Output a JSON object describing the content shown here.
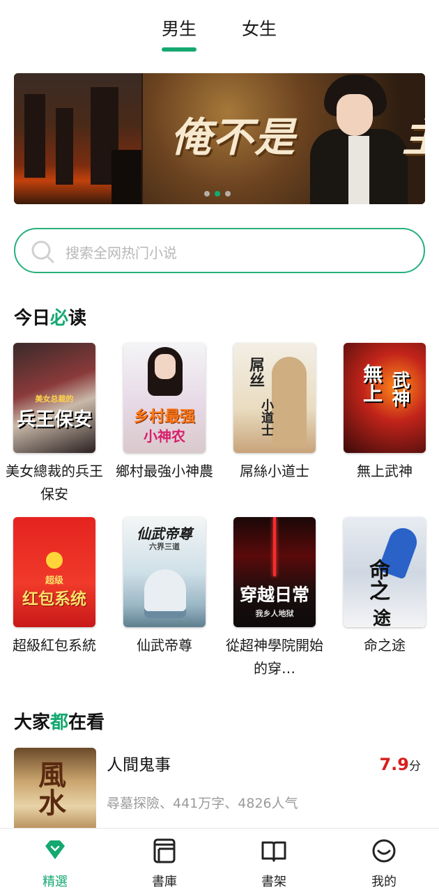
{
  "colors": {
    "accent": "#15a870",
    "score": "#d81e1e",
    "muted": "#9a9a9a"
  },
  "tabs": {
    "male": "男生",
    "female": "女生",
    "active": "male"
  },
  "banner": {
    "title_main": "俺不是",
    "title_tail": "主",
    "slide_count": 3,
    "active_slide": 2
  },
  "search": {
    "placeholder": "搜索全网热门小说",
    "icon": "search-icon"
  },
  "today": {
    "title_pre": "今日",
    "title_accent": "必",
    "title_post": "读",
    "books": [
      {
        "title": "美女總裁的兵王保安",
        "cover_text": "兵王保安",
        "cover_sub": "美女总裁的"
      },
      {
        "title": "鄉村最強小神農",
        "cover_text": "乡村最强",
        "cover_sub": "小神农"
      },
      {
        "title": "屌絲小道士",
        "cover_text": "屌丝",
        "cover_sub": "小道士"
      },
      {
        "title": "無上武神",
        "cover_text": "無上",
        "cover_sub": "武神"
      },
      {
        "title": "超級紅包系統",
        "cover_text": "红包系统",
        "cover_sub": "超级"
      },
      {
        "title": "仙武帝尊",
        "cover_text": "仙武帝尊",
        "cover_sub": "六界三道"
      },
      {
        "title": "從超神學院開始的穿…",
        "cover_text": "穿越日常",
        "cover_sub": "我乡人地狱"
      },
      {
        "title": "命之途",
        "cover_text": "命之",
        "cover_sub": "途"
      }
    ]
  },
  "popular": {
    "title_pre": "大家",
    "title_accent": "都",
    "title_post": "在看",
    "items": [
      {
        "title": "人間鬼事",
        "meta": "尋墓探險、441万字、4826人气",
        "score": "7.9",
        "score_unit": "分",
        "cover_text": "風水"
      }
    ]
  },
  "nav": [
    {
      "label": "精選",
      "icon": "diamond-icon",
      "active": true
    },
    {
      "label": "書庫",
      "icon": "library-icon",
      "active": false
    },
    {
      "label": "書架",
      "icon": "bookshelf-icon",
      "active": false
    },
    {
      "label": "我的",
      "icon": "smiley-icon",
      "active": false
    }
  ]
}
